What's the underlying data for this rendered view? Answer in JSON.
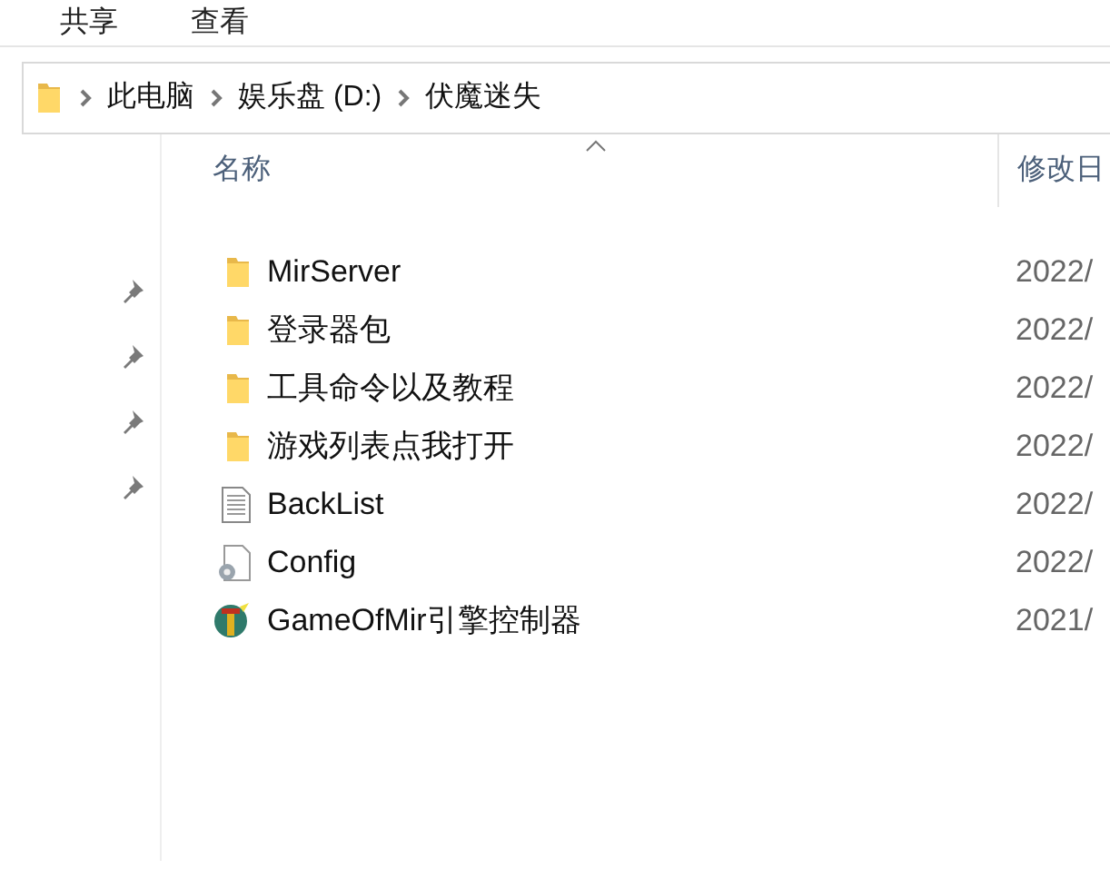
{
  "ribbon_tabs": [
    {
      "label": "共享"
    },
    {
      "label": "查看"
    }
  ],
  "breadcrumb": [
    "此电脑",
    "娱乐盘 (D:)",
    "伏魔迷失"
  ],
  "quick_access": [
    {
      "pinned": true
    },
    {
      "pinned": true
    },
    {
      "pinned": true
    },
    {
      "pinned": true
    }
  ],
  "columns": [
    "名称",
    "修改日"
  ],
  "files": [
    {
      "name": "MirServer",
      "kind": "folder",
      "modified": "2022/"
    },
    {
      "name": "登录器包",
      "kind": "folder",
      "modified": "2022/"
    },
    {
      "name": "工具命令以及教程",
      "kind": "folder",
      "modified": "2022/"
    },
    {
      "name": "游戏列表点我打开",
      "kind": "folder",
      "modified": "2022/"
    },
    {
      "name": "BackList",
      "kind": "text",
      "modified": "2022/"
    },
    {
      "name": "Config",
      "kind": "config",
      "modified": "2022/"
    },
    {
      "name": "GameOfMir引擎控制器",
      "kind": "app",
      "modified": "2021/"
    }
  ]
}
